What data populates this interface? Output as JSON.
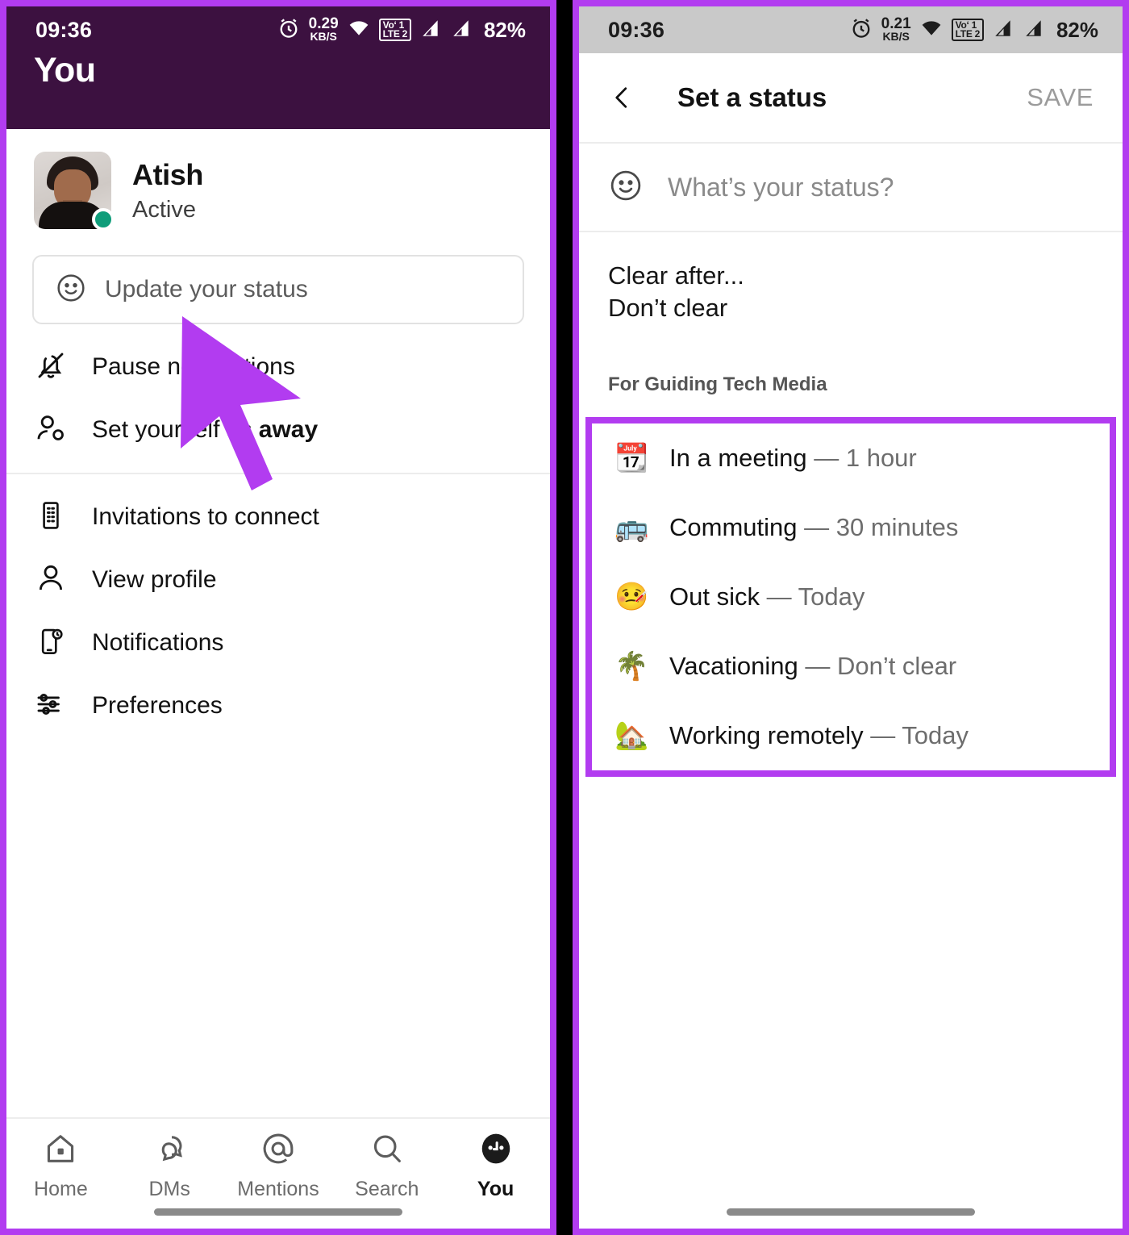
{
  "left_phone": {
    "statusbar": {
      "time": "09:36",
      "net_speed_value": "0.29",
      "net_speed_unit": "KB/S",
      "volte_top": "Vo‘ 1",
      "volte_bottom": "LTE 2",
      "battery": "82%",
      "icons": [
        "alarm-clock-icon",
        "wifi-icon",
        "volte-icon",
        "signal-bar-icon",
        "signal-bar-icon"
      ]
    },
    "header_title": "You",
    "header_bg": "#3c1140",
    "profile": {
      "name": "Atish",
      "presence": "Active",
      "presence_color": "#0f9d7a",
      "avatar_name": "user-avatar"
    },
    "status_input": {
      "placeholder": "Update your status",
      "icon": "smiley-face-icon"
    },
    "menu_group_1": [
      {
        "icon": "bell-slash-icon",
        "label": "Pause notifications"
      },
      {
        "icon": "person-away-icon",
        "label_pre": "Set yourself as ",
        "label_bold": "away"
      }
    ],
    "menu_group_2": [
      {
        "icon": "building-icon",
        "label": "Invitations to connect"
      },
      {
        "icon": "person-icon",
        "label": "View profile"
      },
      {
        "icon": "phone-bell-icon",
        "label": "Notifications"
      },
      {
        "icon": "sliders-icon",
        "label": "Preferences"
      }
    ],
    "tabs": [
      {
        "icon": "home-icon",
        "label": "Home",
        "active": false
      },
      {
        "icon": "chat-bubbles-icon",
        "label": "DMs",
        "active": false
      },
      {
        "icon": "at-sign-icon",
        "label": "Mentions",
        "active": false
      },
      {
        "icon": "search-icon",
        "label": "Search",
        "active": false
      },
      {
        "icon": "avatar-icon",
        "label": "You",
        "active": true
      }
    ]
  },
  "right_phone": {
    "statusbar": {
      "time": "09:36",
      "net_speed_value": "0.21",
      "net_speed_unit": "KB/S",
      "volte_top": "Vo‘ 1",
      "volte_bottom": "LTE 2",
      "battery": "82%"
    },
    "topbar": {
      "back_icon": "chevron-left-icon",
      "title": "Set a status",
      "save_label": "SAVE"
    },
    "status_input": {
      "placeholder": "What’s your status?",
      "icon": "smiley-face-icon"
    },
    "clear_after": {
      "label": "Clear after...",
      "value": "Don’t clear"
    },
    "section_label": "For Guiding Tech Media",
    "presets": [
      {
        "emoji": "📆",
        "emoji_name": "spiral-calendar-emoji",
        "text": "In a meeting",
        "duration": "1 hour"
      },
      {
        "emoji": "🚌",
        "emoji_name": "bus-emoji",
        "text": "Commuting",
        "duration": "30 minutes"
      },
      {
        "emoji": "🤒",
        "emoji_name": "face-with-thermometer-emoji",
        "text": "Out sick",
        "duration": "Today"
      },
      {
        "emoji": "🌴",
        "emoji_name": "palm-tree-emoji",
        "text": "Vacationing",
        "duration": "Don’t clear"
      },
      {
        "emoji": "🏡",
        "emoji_name": "house-with-garden-emoji",
        "text": "Working remotely",
        "duration": "Today"
      }
    ]
  },
  "annotations": {
    "highlight_color": "#b23cf0",
    "cursor_name": "mouse-cursor-arrow"
  },
  "separator": " — "
}
